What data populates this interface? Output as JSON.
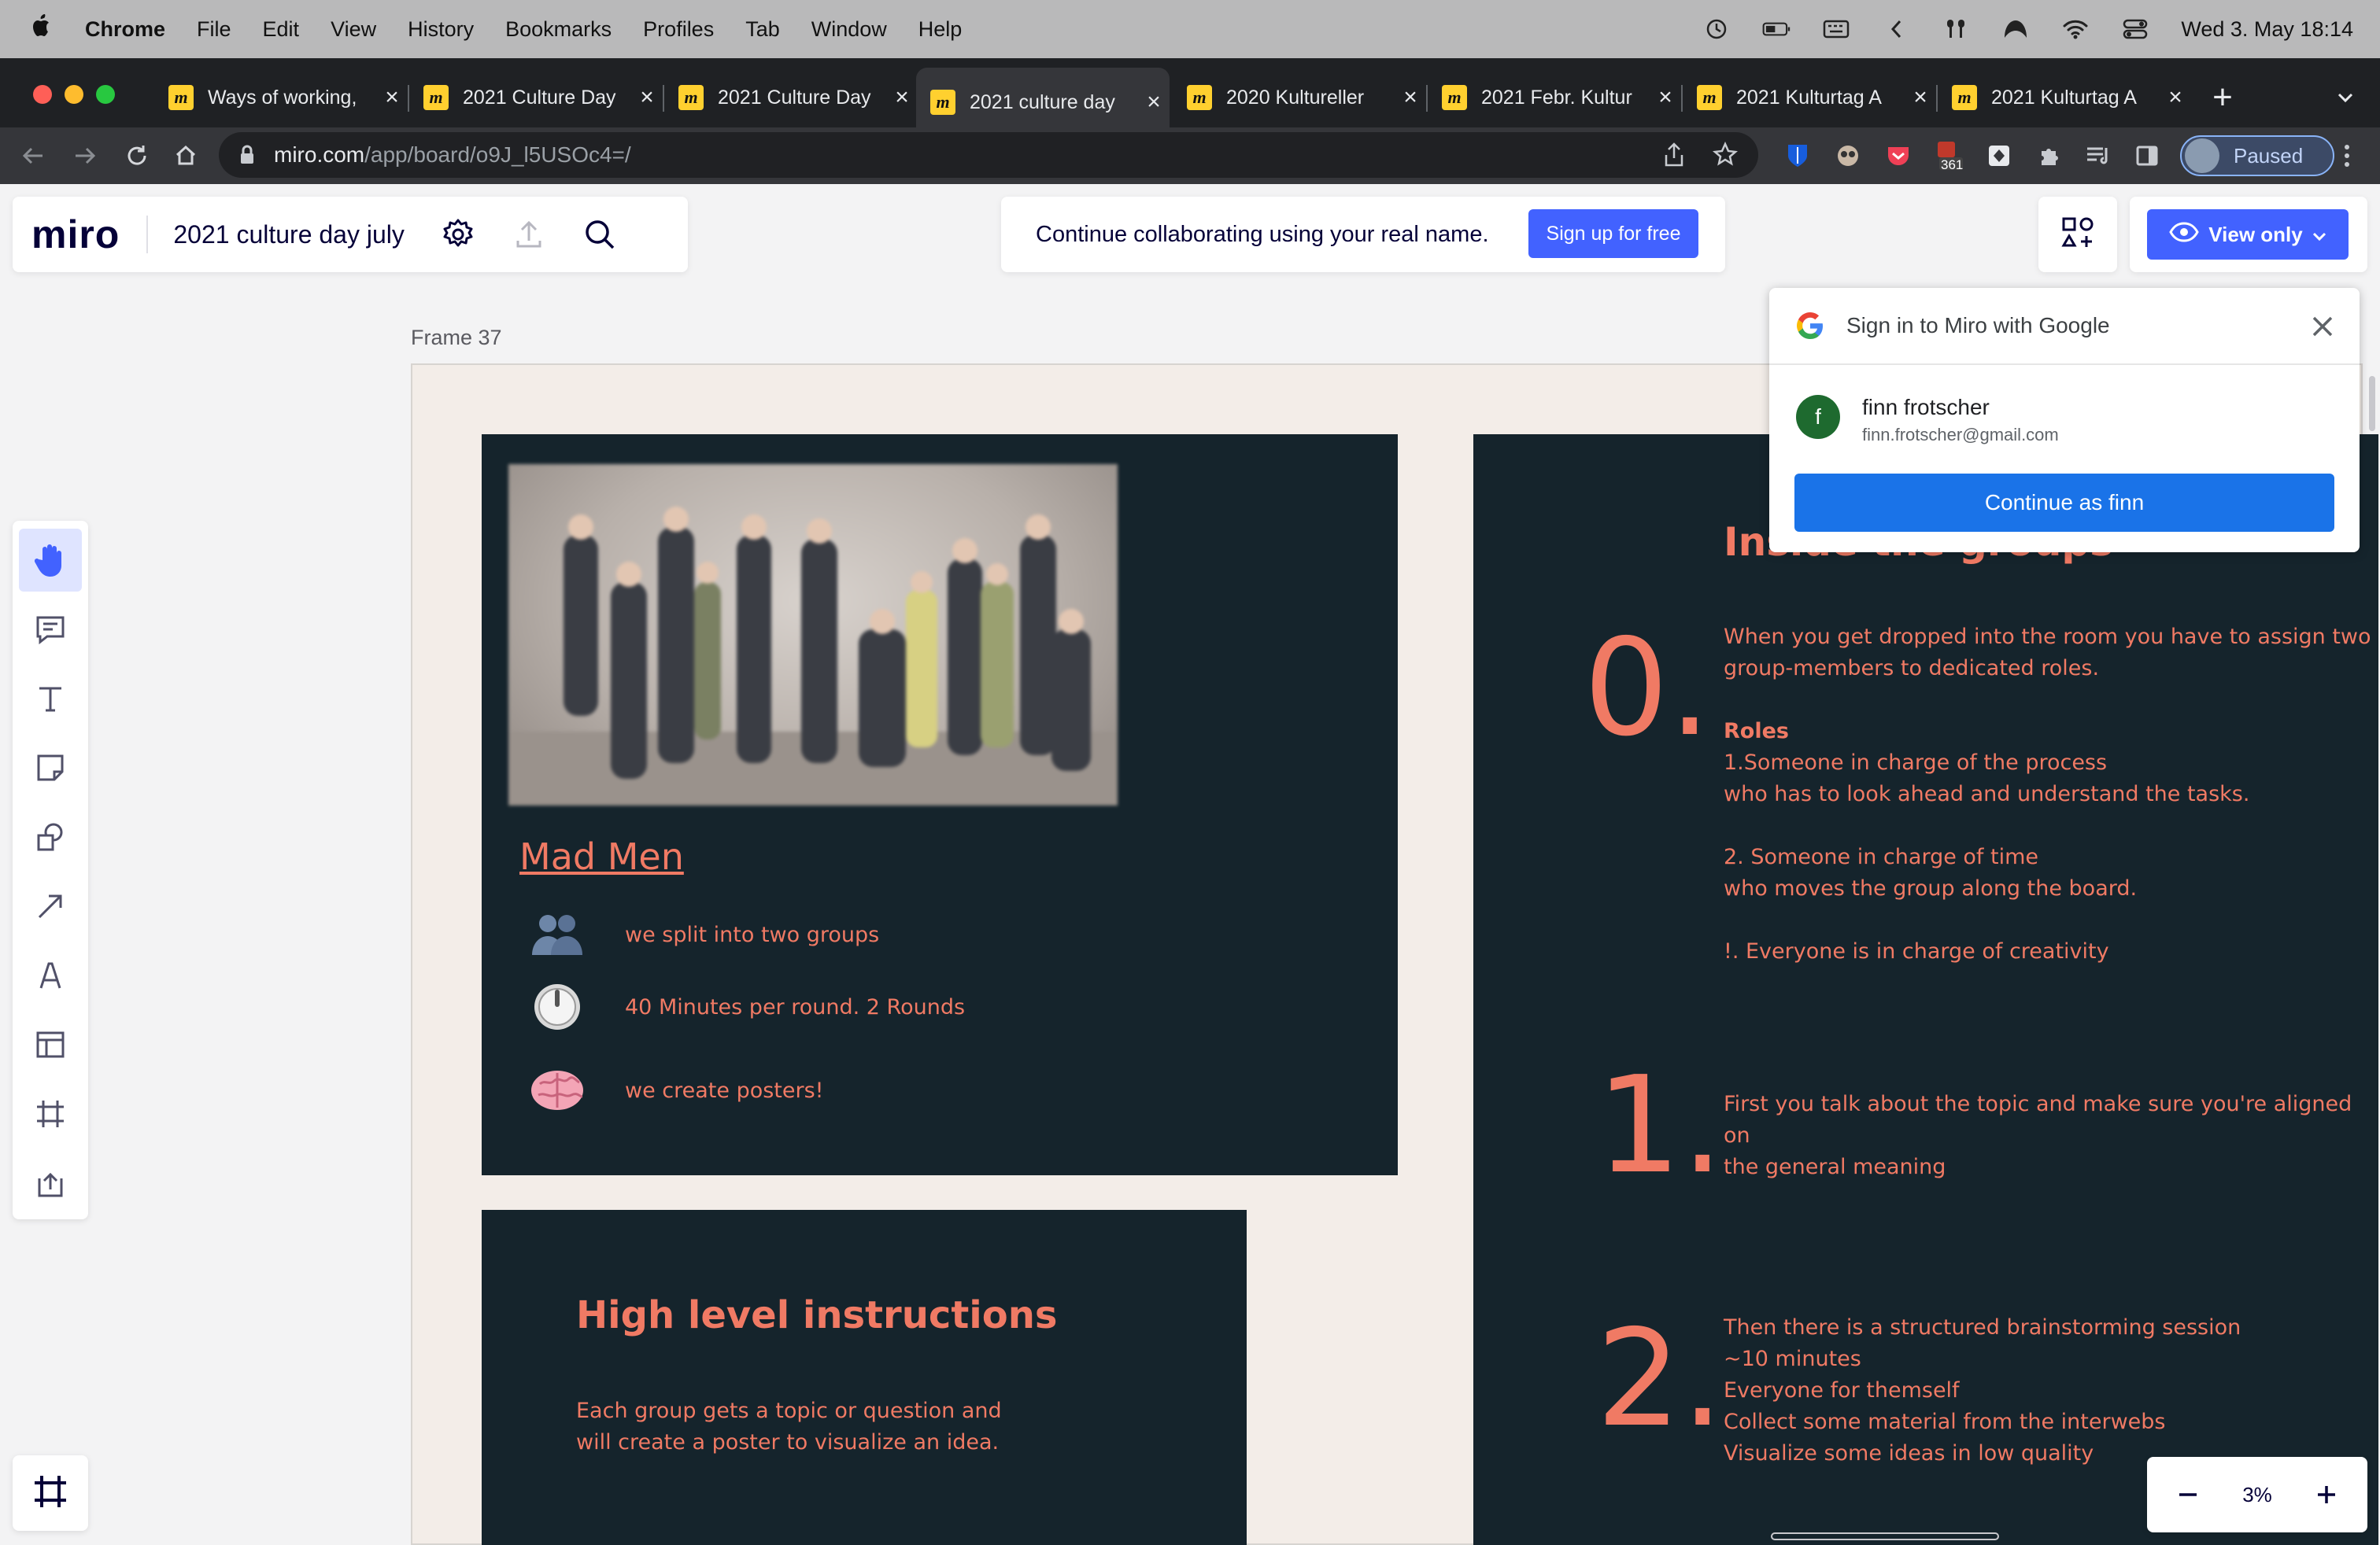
{
  "menubar": {
    "app": "Chrome",
    "items": [
      "File",
      "Edit",
      "View",
      "History",
      "Bookmarks",
      "Profiles",
      "Tab",
      "Window",
      "Help"
    ],
    "datetime": "Wed 3. May  18:14"
  },
  "tabs": [
    {
      "label": "Ways of working,",
      "active": false
    },
    {
      "label": "2021 Culture Day",
      "active": false
    },
    {
      "label": "2021 Culture Day",
      "active": false
    },
    {
      "label": "2021 culture day",
      "active": true
    },
    {
      "label": "2020 Kultureller",
      "active": false
    },
    {
      "label": "2021 Febr. Kultur",
      "active": false
    },
    {
      "label": "2021 Kulturtag A",
      "active": false
    },
    {
      "label": "2021 Kulturtag A",
      "active": false
    }
  ],
  "address": {
    "host": "miro.com",
    "path": "/app/board/o9J_l5USOc4=/"
  },
  "profile": {
    "status": "Paused"
  },
  "extension_badge": "361",
  "miro": {
    "logo": "miro",
    "board_title": "2021 culture day july",
    "signup_text": "Continue collaborating using your real name.",
    "signup_button": "Sign up for free",
    "view_only": "View only"
  },
  "frame": {
    "label": "Frame 37"
  },
  "madmen": {
    "link": "Mad Men",
    "bullets": [
      "we split into two groups",
      "40 Minutes per round. 2 Rounds",
      "we create posters!"
    ]
  },
  "instructions": {
    "title": "High level instructions",
    "body_line1": "Each group gets a topic or question and",
    "body_line2": "will create a poster to visualize an idea."
  },
  "groups": {
    "heading": "Inside the groups",
    "steps": [
      {
        "num": "0.",
        "lines": [
          "When you get dropped into the room you have to assign two",
          "group-members to dedicated roles.",
          "",
          "Roles",
          "1.Someone in charge of the process",
          "who has to look ahead and understand the tasks.",
          "",
          "2. Someone in charge of time",
          "who moves the group along the board.",
          "",
          "!. Everyone is in charge of creativity"
        ]
      },
      {
        "num": "1.",
        "lines": [
          "First you talk about the topic and make sure you're aligned on",
          "the general meaning"
        ]
      },
      {
        "num": "2.",
        "lines": [
          "Then there is a structured brainstorming session",
          "~10 minutes",
          "Everyone for themself",
          "Collect some material from the interwebs",
          "Visualize some ideas in low quality"
        ]
      }
    ]
  },
  "google_popup": {
    "title": "Sign in to Miro with Google",
    "account_initial": "f",
    "account_name": "finn frotscher",
    "account_email": "finn.frotscher@gmail.com",
    "continue": "Continue as finn"
  },
  "zoom": {
    "level": "3%"
  },
  "colors": {
    "accent": "#4262ff",
    "panel": "#15242c",
    "salmon": "#f07a64",
    "frame_bg": "#f3ede8",
    "google_blue": "#1a73e8"
  }
}
